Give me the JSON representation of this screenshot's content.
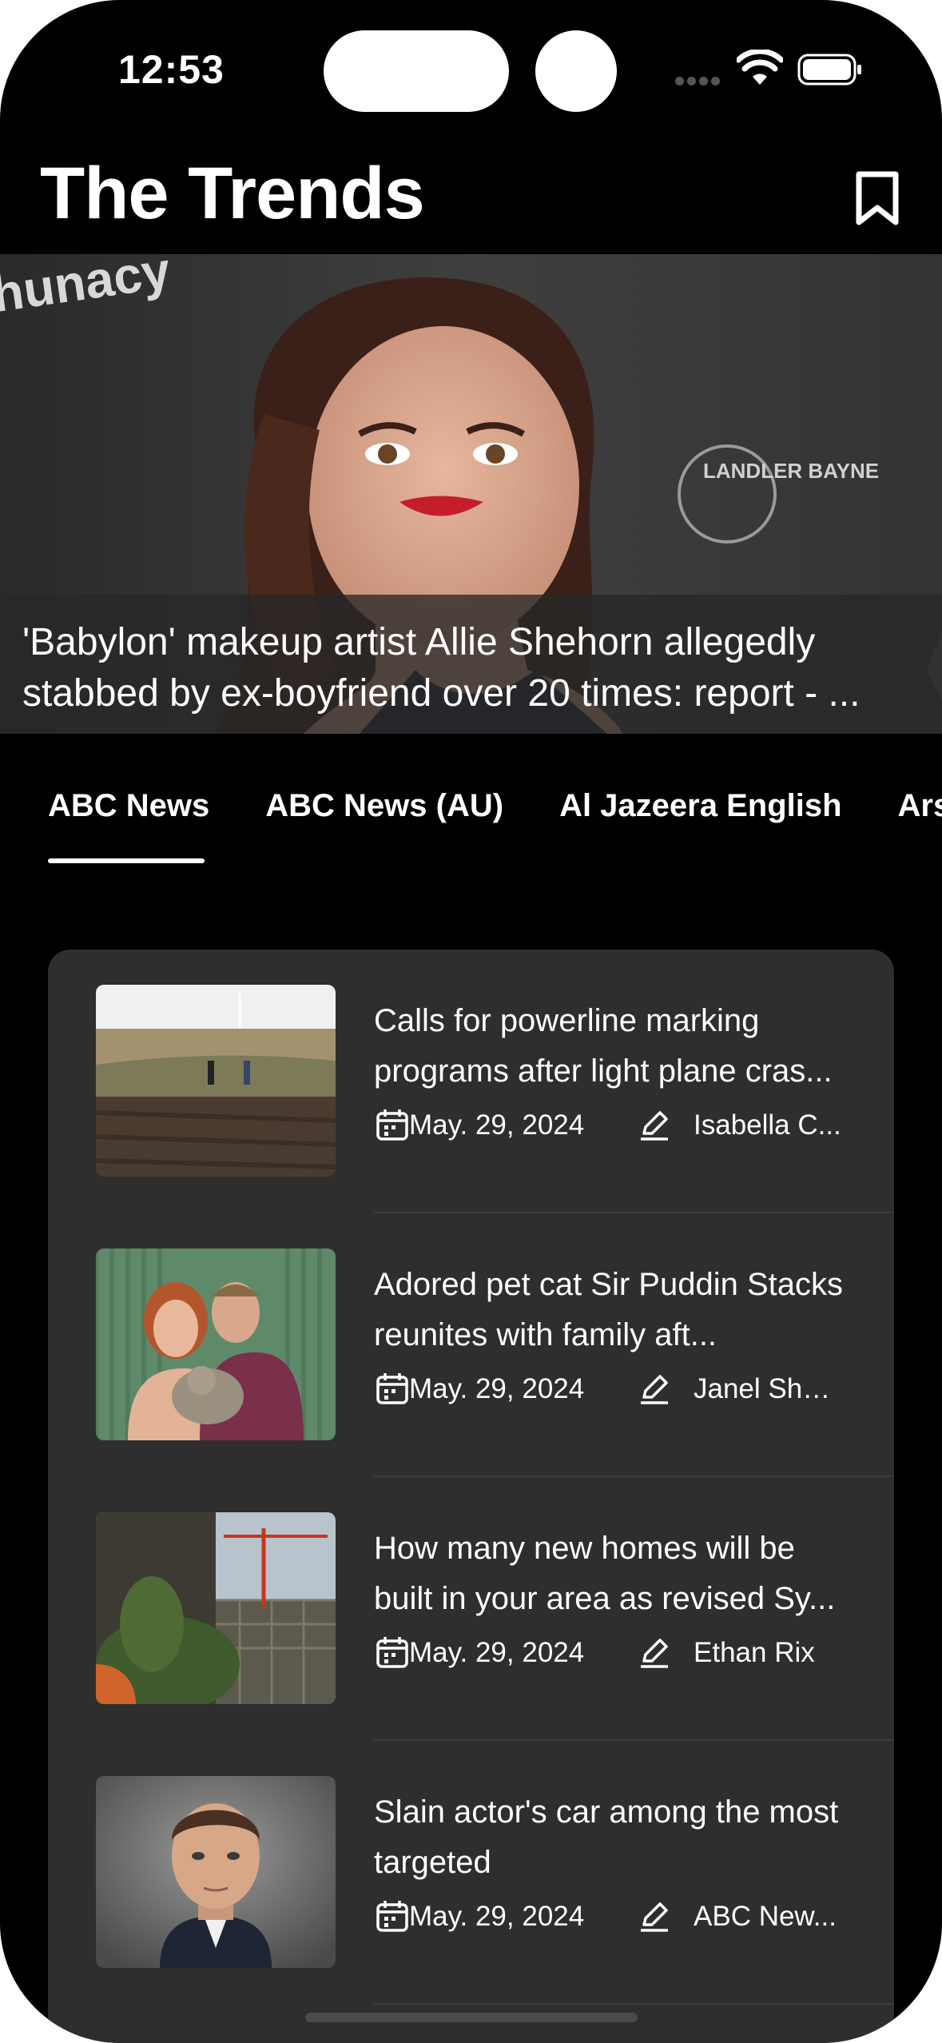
{
  "status_bar": {
    "time": "12:53"
  },
  "header": {
    "title": "The Trends"
  },
  "hero": {
    "headline": "'Babylon' makeup artist Allie Shehorn allegedly stabbed by ex-boyfriend over 20 times: report - ...",
    "image_text_left": "hunacy",
    "image_text_right": "LANDLER BAYNE"
  },
  "tabs": [
    {
      "label": "ABC News",
      "selected": true
    },
    {
      "label": "ABC News (AU)",
      "selected": false
    },
    {
      "label": "Al Jazeera English",
      "selected": false
    },
    {
      "label": "Ars T",
      "selected": false
    }
  ],
  "articles": [
    {
      "title": "Calls for powerline marking programs after light plane cras...",
      "date": "May. 29, 2024",
      "author": "Isabella C..."
    },
    {
      "title": "Adored pet cat Sir Puddin Stacks reunites with family aft...",
      "date": "May. 29, 2024",
      "author": "Janel Shor..."
    },
    {
      "title": "How many new homes will be built in your area as revised Sy...",
      "date": "May. 29, 2024",
      "author": "Ethan Rix"
    },
    {
      "title": "Slain actor's car among the most targeted",
      "date": "May. 29, 2024",
      "author": "ABC New..."
    }
  ],
  "colors": {
    "background": "#000000",
    "card": "#2e2e2e",
    "text": "#ffffff"
  }
}
